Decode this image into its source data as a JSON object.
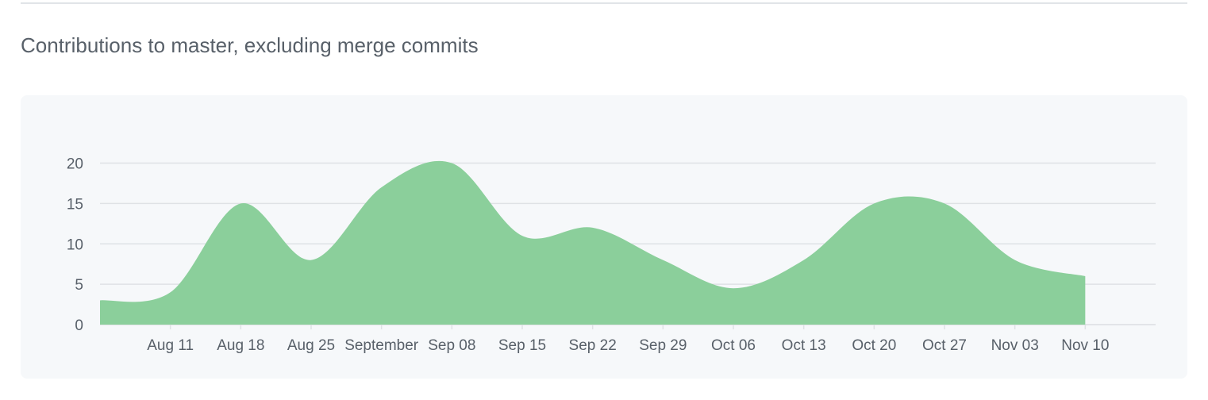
{
  "header": {
    "title": "Contributions to master, excluding merge commits"
  },
  "colors": {
    "area_fill": "#8bcf9b",
    "grid": "#dfe2e5",
    "axis_text": "#586069",
    "panel_bg": "#f6f8fa"
  },
  "chart_data": {
    "type": "area",
    "title": "Contributions to master, excluding merge commits",
    "xlabel": "",
    "ylabel": "",
    "ylim": [
      0,
      23
    ],
    "yticks": [
      0,
      5,
      10,
      15,
      20
    ],
    "grid": true,
    "x_ticks": [
      {
        "date": "2019-08-11",
        "label": "Aug 11"
      },
      {
        "date": "2019-08-18",
        "label": "Aug 18"
      },
      {
        "date": "2019-08-25",
        "label": "Aug 25"
      },
      {
        "date": "2019-09-01",
        "label": "September"
      },
      {
        "date": "2019-09-08",
        "label": "Sep 08"
      },
      {
        "date": "2019-09-15",
        "label": "Sep 15"
      },
      {
        "date": "2019-09-22",
        "label": "Sep 22"
      },
      {
        "date": "2019-09-29",
        "label": "Sep 29"
      },
      {
        "date": "2019-10-06",
        "label": "Oct 06"
      },
      {
        "date": "2019-10-13",
        "label": "Oct 13"
      },
      {
        "date": "2019-10-20",
        "label": "Oct 20"
      },
      {
        "date": "2019-10-27",
        "label": "Oct 27"
      },
      {
        "date": "2019-11-03",
        "label": "Nov 03"
      },
      {
        "date": "2019-11-10",
        "label": "Nov 10"
      }
    ],
    "x_range": [
      "2019-08-04",
      "2019-11-17"
    ],
    "series": [
      {
        "points": [
          {
            "x": "2019-08-04",
            "y": 3
          },
          {
            "x": "2019-08-11",
            "y": 4
          },
          {
            "x": "2019-08-18",
            "y": 15
          },
          {
            "x": "2019-08-25",
            "y": 8
          },
          {
            "x": "2019-09-01",
            "y": 17
          },
          {
            "x": "2019-09-08",
            "y": 20
          },
          {
            "x": "2019-09-15",
            "y": 11
          },
          {
            "x": "2019-09-22",
            "y": 12
          },
          {
            "x": "2019-09-29",
            "y": 8
          },
          {
            "x": "2019-10-06",
            "y": 4.5
          },
          {
            "x": "2019-10-13",
            "y": 8
          },
          {
            "x": "2019-10-20",
            "y": 15
          },
          {
            "x": "2019-10-27",
            "y": 15
          },
          {
            "x": "2019-11-03",
            "y": 8
          },
          {
            "x": "2019-11-10",
            "y": 6
          }
        ]
      }
    ]
  }
}
